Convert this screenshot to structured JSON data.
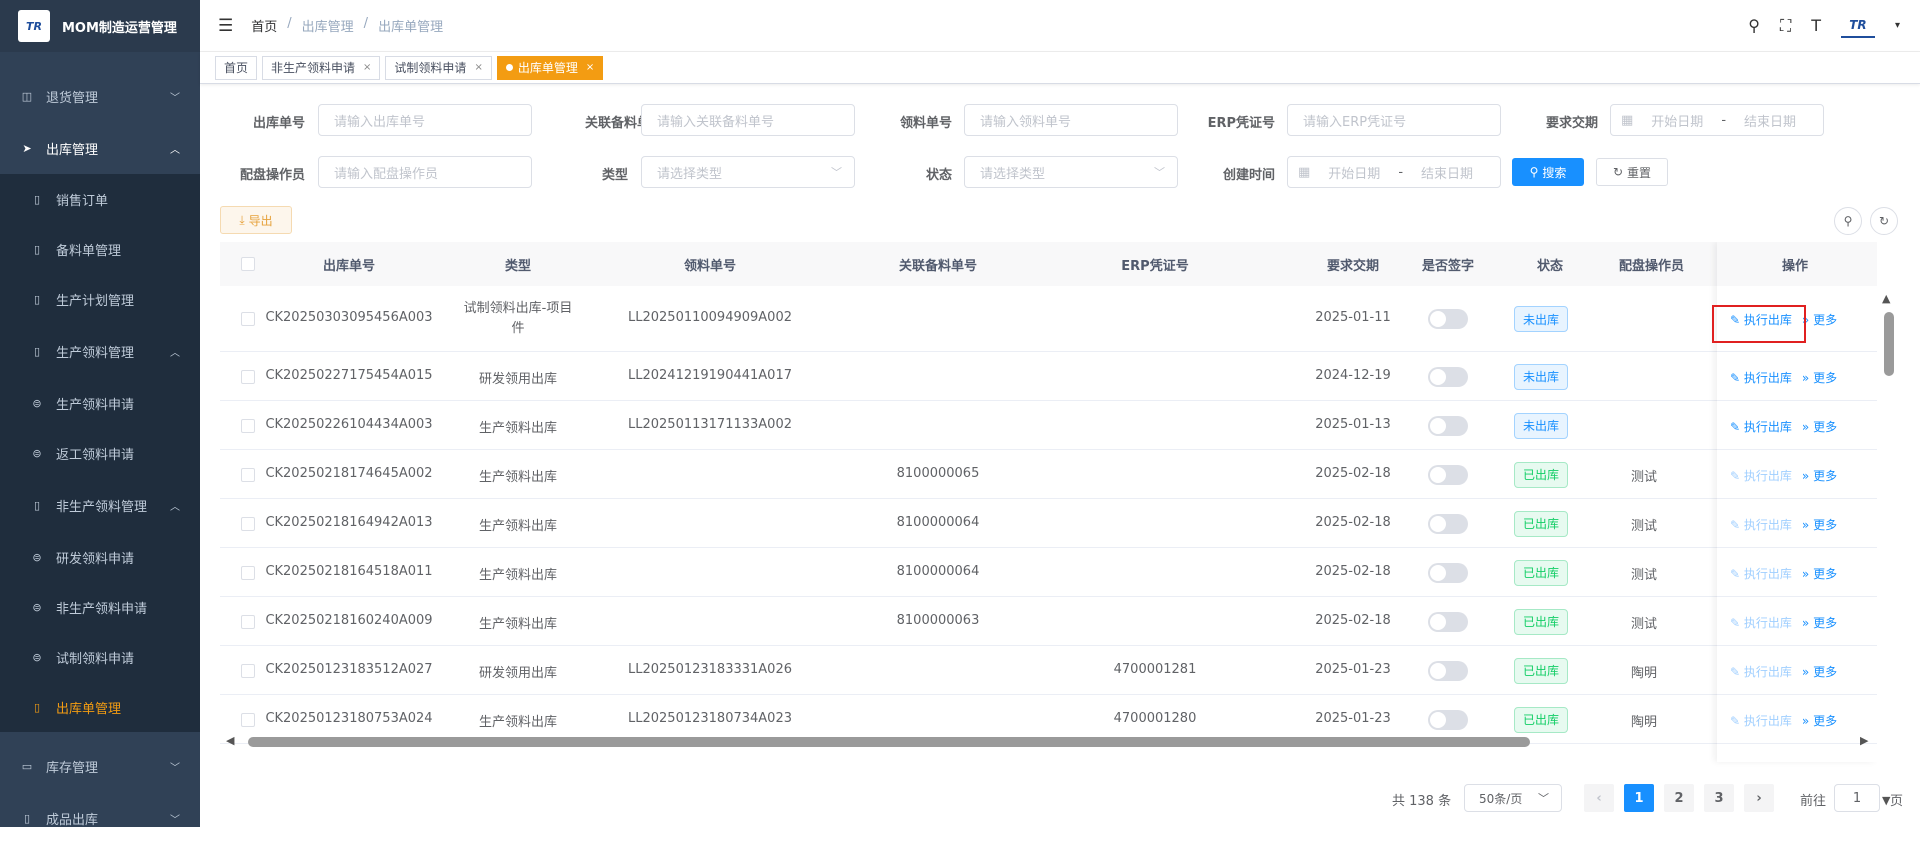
{
  "app": {
    "title": "MOM制造运营管理",
    "logo": "TR"
  },
  "sidebar": {
    "items": [
      {
        "label": "退货管理",
        "icon": "return-icon"
      },
      {
        "label": "出库管理",
        "icon": "send-icon"
      },
      {
        "label": "销售订单",
        "icon": "book-icon"
      },
      {
        "label": "备料单管理",
        "icon": "book-icon"
      },
      {
        "label": "生产计划管理",
        "icon": "book-icon"
      },
      {
        "label": "生产领料管理",
        "icon": "book-icon"
      },
      {
        "label": "生产领料申请",
        "icon": "box-icon"
      },
      {
        "label": "返工领料申请",
        "icon": "box-icon"
      },
      {
        "label": "非生产领料管理",
        "icon": "book-icon"
      },
      {
        "label": "研发领料申请",
        "icon": "box-icon"
      },
      {
        "label": "非生产领料申请",
        "icon": "box-icon"
      },
      {
        "label": "试制领料申请",
        "icon": "box-icon"
      },
      {
        "label": "出库单管理",
        "icon": "book-icon"
      },
      {
        "label": "库存管理",
        "icon": "monitor-icon"
      },
      {
        "label": "成品出库",
        "icon": "book-icon"
      }
    ]
  },
  "breadcrumb": [
    "首页",
    "/",
    "出库管理",
    "/",
    "出库单管理"
  ],
  "tags": [
    {
      "label": "首页"
    },
    {
      "label": "非生产领料申请"
    },
    {
      "label": "试制领料申请"
    },
    {
      "label": "出库单管理"
    }
  ],
  "filters": {
    "outbound_no": {
      "label": "出库单号",
      "placeholder": "请输入出库单号"
    },
    "related_no": {
      "label": "关联备料单号",
      "placeholder": "请输入关联备料单号"
    },
    "pick_no": {
      "label": "领料单号",
      "placeholder": "请输入领料单号"
    },
    "erp_no": {
      "label": "ERP凭证号",
      "placeholder": "请输入ERP凭证号"
    },
    "due": {
      "label": "要求交期",
      "start": "开始日期",
      "sep": "-",
      "end": "结束日期"
    },
    "operator": {
      "label": "配盘操作员",
      "placeholder": "请输入配盘操作员"
    },
    "type": {
      "label": "类型",
      "placeholder": "请选择类型"
    },
    "status": {
      "label": "状态",
      "placeholder": "请选择类型"
    },
    "created": {
      "label": "创建时间",
      "start": "开始日期",
      "sep": "-",
      "end": "结束日期"
    },
    "search": "搜索",
    "reset": "重置",
    "export": "导出"
  },
  "table": {
    "headers": [
      "出库单号",
      "类型",
      "领料单号",
      "关联备料单号",
      "ERP凭证号",
      "要求交期",
      "是否签字",
      "状态",
      "配盘操作员",
      "操作"
    ],
    "exec_label": "执行出库",
    "more_label": "更多",
    "rows": [
      {
        "no": "CK20250303095456A003",
        "type": "试制领料出库-项目件",
        "pick": "LL20250110094909A002",
        "rel": "",
        "erp": "",
        "due": "2025-01-11",
        "status": "未出库",
        "op": "",
        "done": false
      },
      {
        "no": "CK20250227175454A015",
        "type": "研发领用出库",
        "pick": "LL20241219190441A017",
        "rel": "",
        "erp": "",
        "due": "2024-12-19",
        "status": "未出库",
        "op": "",
        "done": false
      },
      {
        "no": "CK20250226104434A003",
        "type": "生产领料出库",
        "pick": "LL20250113171133A002",
        "rel": "",
        "erp": "",
        "due": "2025-01-13",
        "status": "未出库",
        "op": "",
        "done": false
      },
      {
        "no": "CK20250218174645A002",
        "type": "生产领料出库",
        "pick": "",
        "rel": "8100000065",
        "erp": "",
        "due": "2025-02-18",
        "status": "已出库",
        "op": "测试",
        "done": true
      },
      {
        "no": "CK20250218164942A013",
        "type": "生产领料出库",
        "pick": "",
        "rel": "8100000064",
        "erp": "",
        "due": "2025-02-18",
        "status": "已出库",
        "op": "测试",
        "done": true
      },
      {
        "no": "CK20250218164518A011",
        "type": "生产领料出库",
        "pick": "",
        "rel": "8100000064",
        "erp": "",
        "due": "2025-02-18",
        "status": "已出库",
        "op": "测试",
        "done": true
      },
      {
        "no": "CK20250218160240A009",
        "type": "生产领料出库",
        "pick": "",
        "rel": "8100000063",
        "erp": "",
        "due": "2025-02-18",
        "status": "已出库",
        "op": "测试",
        "done": true
      },
      {
        "no": "CK20250123183512A027",
        "type": "研发领用出库",
        "pick": "LL20250123183331A026",
        "rel": "",
        "erp": "4700001281",
        "due": "2025-01-23",
        "status": "已出库",
        "op": "陶明",
        "done": true
      },
      {
        "no": "CK20250123180753A024",
        "type": "生产领料出库",
        "pick": "LL20250123180734A023",
        "rel": "",
        "erp": "4700001280",
        "due": "2025-01-23",
        "status": "已出库",
        "op": "陶明",
        "done": true
      }
    ]
  },
  "pagination": {
    "total": "共 138 条",
    "size": "50条/页",
    "pages": [
      "1",
      "2",
      "3"
    ],
    "goto": "前往",
    "goto_value": "1",
    "page_unit": "页"
  }
}
